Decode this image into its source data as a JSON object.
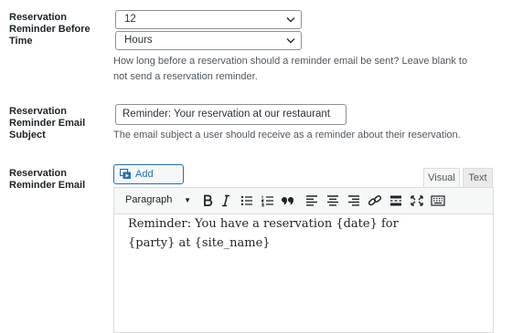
{
  "reminder_before_time": {
    "label": "Reservation Reminder Before Time",
    "amount_value": "12",
    "unit_value": "Hours",
    "description": "How long before a reservation should a reminder email be sent? Leave blank to not send a reservation reminder."
  },
  "reminder_subject": {
    "label": "Reservation Reminder Email Subject",
    "value": "Reminder: Your reservation at our restaurant",
    "description": "The email subject a user should receive as a reminder about their reservation."
  },
  "reminder_email": {
    "label": "Reservation Reminder Email",
    "add_media_label": "Add Media",
    "tabs": {
      "visual": "Visual",
      "text": "Text"
    },
    "format_value": "Paragraph",
    "body_text": "Reminder: You have a reservation {date} for {party} at {site_name}"
  },
  "icons": {
    "select_arrow": "chevron-down-icon",
    "add_media": "media-icon",
    "toolbar": [
      "bold-icon",
      "italic-icon",
      "bullet-list-icon",
      "numbered-list-icon",
      "blockquote-icon",
      "align-left-icon",
      "align-center-icon",
      "align-right-icon",
      "link-icon",
      "read-more-icon",
      "fullscreen-icon",
      "toolbar-toggle-icon"
    ]
  },
  "colors": {
    "accent": "#2271b1",
    "text": "#1d2327",
    "muted": "#50575e",
    "border": "#8c8f94"
  }
}
